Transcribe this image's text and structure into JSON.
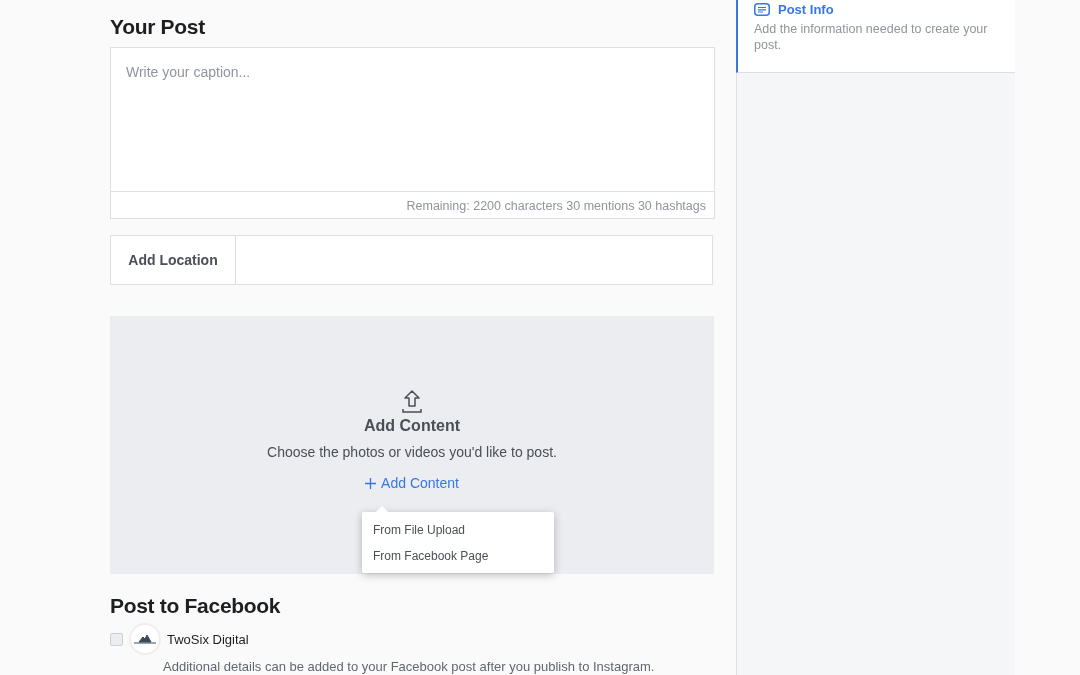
{
  "post": {
    "title": "Your Post",
    "caption": {
      "placeholder": "Write your caption..."
    },
    "remaining": "Remaining: 2200 characters 30 mentions 30 hashtags",
    "location": {
      "label": "Add Location"
    }
  },
  "content": {
    "title": "Add Content",
    "description": "Choose the photos or videos you'd like to post.",
    "add_link": "Add Content",
    "menu": [
      "From File Upload",
      "From Facebook Page"
    ]
  },
  "facebook": {
    "title": "Post to Facebook",
    "pages": [
      {
        "name": "TwoSix Digital",
        "checked": false
      }
    ],
    "note": "Additional details can be added to your Facebook post after you publish to Instagram."
  },
  "sidebar": {
    "steps": [
      {
        "title": "Post Info",
        "description": "Add the information needed to create your post.",
        "selected": true
      }
    ]
  }
}
